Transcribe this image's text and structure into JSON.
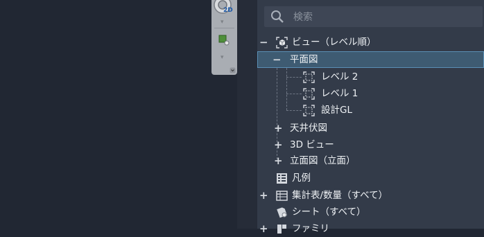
{
  "search": {
    "placeholder": "検索"
  },
  "navbar": {
    "badge": "2D"
  },
  "tree": [
    {
      "label": "ビュー（レベル順）",
      "toggle": "−",
      "icon": "view-cube-icon"
    },
    {
      "label": "平面図",
      "toggle": "−",
      "selected": true
    },
    {
      "label": "レベル 2",
      "icon": "floor-plan-view-icon"
    },
    {
      "label": "レベル 1",
      "icon": "floor-plan-view-icon"
    },
    {
      "label": "設計GL",
      "icon": "floor-plan-view-icon"
    },
    {
      "label": "天井伏図",
      "toggle": "+"
    },
    {
      "label": "3D ビュー",
      "toggle": "+"
    },
    {
      "label": "立面図（立面）",
      "toggle": "+"
    },
    {
      "label": "凡例",
      "icon": "legend-icon"
    },
    {
      "label": "集計表/数量（すべて）",
      "toggle": "+",
      "icon": "schedule-table-icon"
    },
    {
      "label": "シート（すべて）",
      "icon": "sheet-icon"
    },
    {
      "label": "ファミリ",
      "toggle": "+",
      "icon": "family-icon"
    }
  ],
  "colors": {
    "selection": "#3e5b72",
    "panel": "#333b49",
    "canvas": "#212733"
  }
}
